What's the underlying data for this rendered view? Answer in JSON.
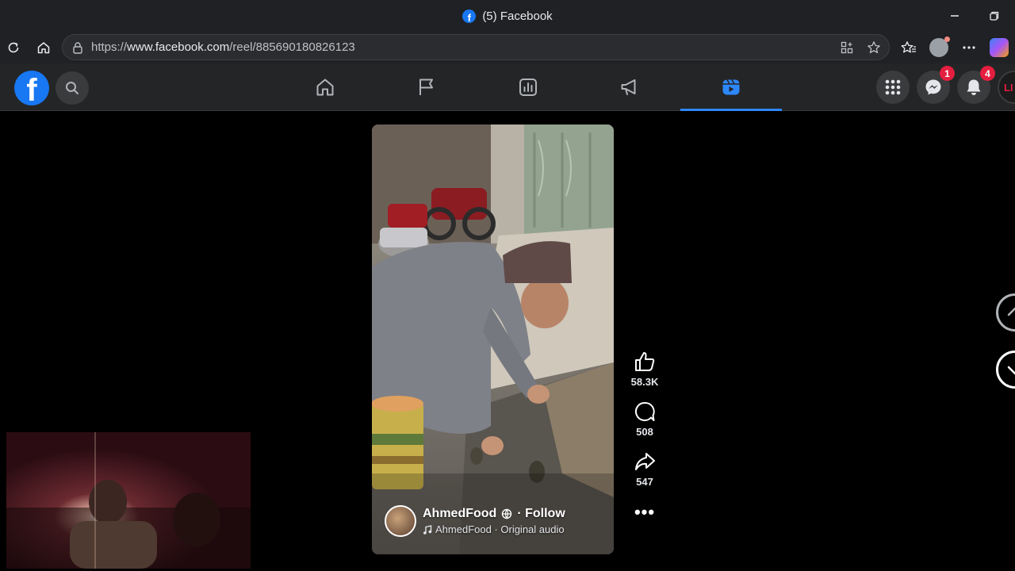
{
  "browser": {
    "tab_title": "(5) Facebook",
    "url_prefix": "https://",
    "url_domain": "www.facebook.com",
    "url_path": "/reel/885690180826123"
  },
  "header": {
    "nav": [
      {
        "name": "Home",
        "icon": "home-icon"
      },
      {
        "name": "Pages",
        "icon": "flag-icon"
      },
      {
        "name": "Insights",
        "icon": "chart-icon"
      },
      {
        "name": "Ads",
        "icon": "megaphone-icon"
      },
      {
        "name": "Reels",
        "icon": "reels-icon",
        "active": true
      }
    ],
    "messenger_badge": "1",
    "notifications_badge": "4",
    "avatar_text": "LI"
  },
  "reel": {
    "creator_name": "AhmedFood",
    "follow_label": "· Follow",
    "audio_label": "AhmedFood · Original audio",
    "likes": "58.3K",
    "comments": "508",
    "shares": "547",
    "more_label": "•••"
  },
  "colors": {
    "accent": "#1877f2",
    "badge": "#e41e3f",
    "header_bg": "#242526"
  }
}
